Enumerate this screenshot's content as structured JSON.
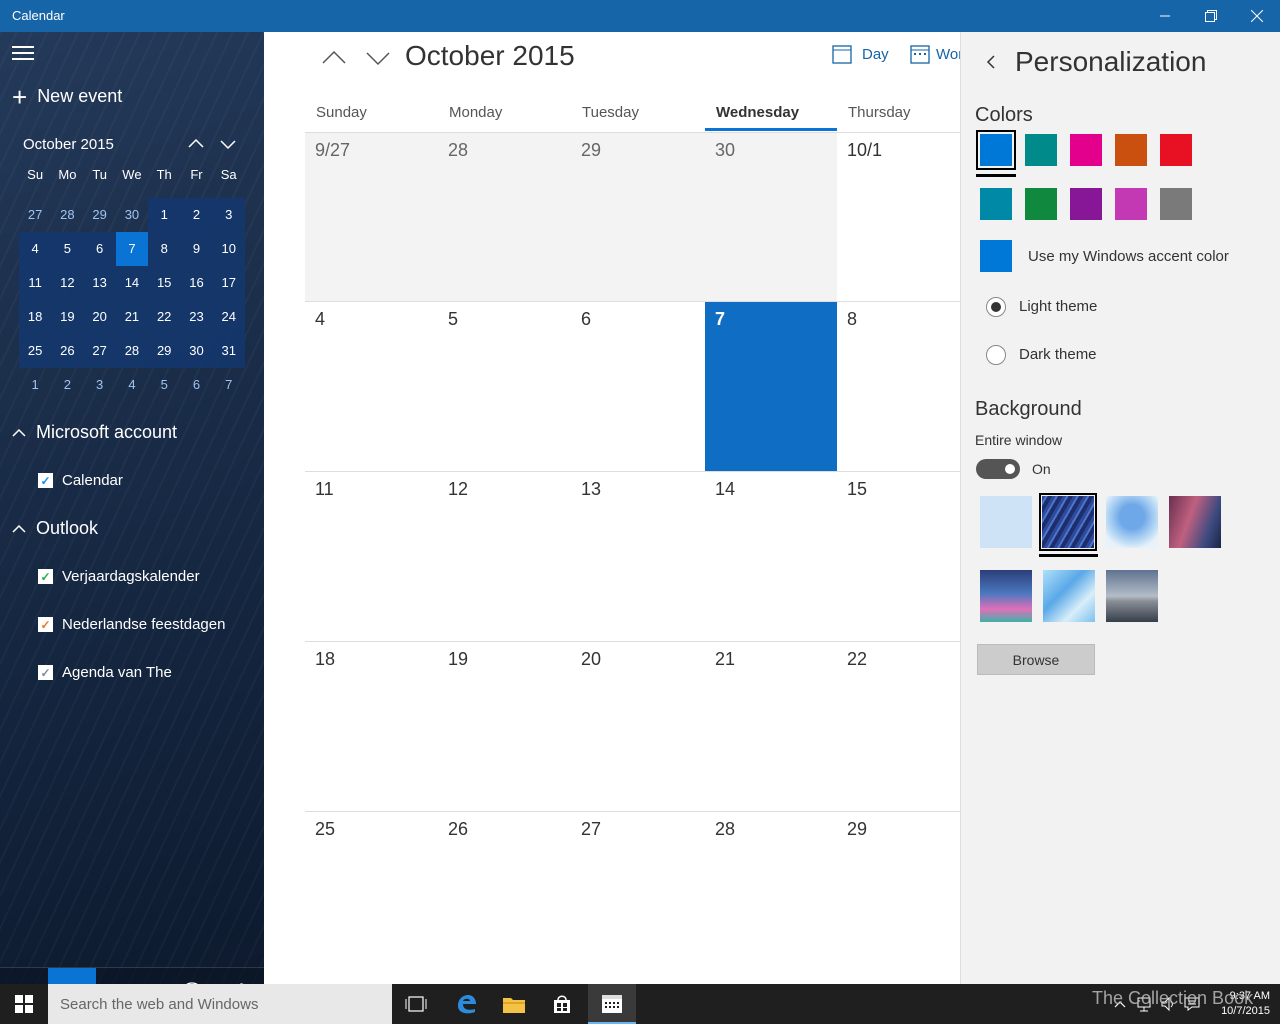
{
  "app_title": "Calendar",
  "sidebar": {
    "new_event": "New event",
    "mini_calendar": {
      "month": "October 2015",
      "dow": [
        "Su",
        "Mo",
        "Tu",
        "We",
        "Th",
        "Fr",
        "Sa"
      ],
      "weeks": [
        [
          "27",
          "28",
          "29",
          "30",
          "1",
          "2",
          "3"
        ],
        [
          "4",
          "5",
          "6",
          "7",
          "8",
          "9",
          "10"
        ],
        [
          "11",
          "12",
          "13",
          "14",
          "15",
          "16",
          "17"
        ],
        [
          "18",
          "19",
          "20",
          "21",
          "22",
          "23",
          "24"
        ],
        [
          "25",
          "26",
          "27",
          "28",
          "29",
          "30",
          "31"
        ],
        [
          "1",
          "2",
          "3",
          "4",
          "5",
          "6",
          "7"
        ]
      ],
      "today": "7"
    },
    "sections": [
      {
        "name": "Microsoft account",
        "calendars": [
          {
            "name": "Calendar",
            "color": "#1e8fe0"
          }
        ]
      },
      {
        "name": "Outlook",
        "calendars": [
          {
            "name": "Verjaardagskalender",
            "color": "#2da84e"
          },
          {
            "name": "Nederlandse feestdagen",
            "color": "#e57a2b"
          },
          {
            "name": "Agenda van The",
            "color": "#7a8fa0"
          }
        ]
      }
    ]
  },
  "main": {
    "month_title": "October 2015",
    "views": [
      "Day",
      "Wor"
    ],
    "day_headers": [
      "Sunday",
      "Monday",
      "Tuesday",
      "Wednesday",
      "Thursday"
    ],
    "selected_day_header": "Wednesday",
    "weeks": [
      [
        "9/27",
        "28",
        "29",
        "30",
        "10/1"
      ],
      [
        "4",
        "5",
        "6",
        "7",
        "8"
      ],
      [
        "11",
        "12",
        "13",
        "14",
        "15"
      ],
      [
        "18",
        "19",
        "20",
        "21",
        "22"
      ],
      [
        "25",
        "26",
        "27",
        "28",
        "29"
      ]
    ],
    "today": "7"
  },
  "panel": {
    "title": "Personalization",
    "colors_heading": "Colors",
    "colors": [
      "#0078d7",
      "#008a8a",
      "#e3008c",
      "#ca5010",
      "#e81123",
      "#0089a6",
      "#10893e",
      "#881798",
      "#c239b3",
      "#7a7a7a"
    ],
    "selected_color": "#0078d7",
    "accent_label": "Use my Windows accent color",
    "accent_color": "#0078d7",
    "light_theme": "Light theme",
    "dark_theme": "Dark theme",
    "theme_selected": "Light theme",
    "background_heading": "Background",
    "entire_window": "Entire window",
    "toggle_state": "On",
    "browse": "Browse"
  },
  "taskbar": {
    "search_placeholder": "Search the web and Windows",
    "time": "9:37 AM",
    "date": "10/7/2015"
  },
  "watermark": "The Collection Book"
}
